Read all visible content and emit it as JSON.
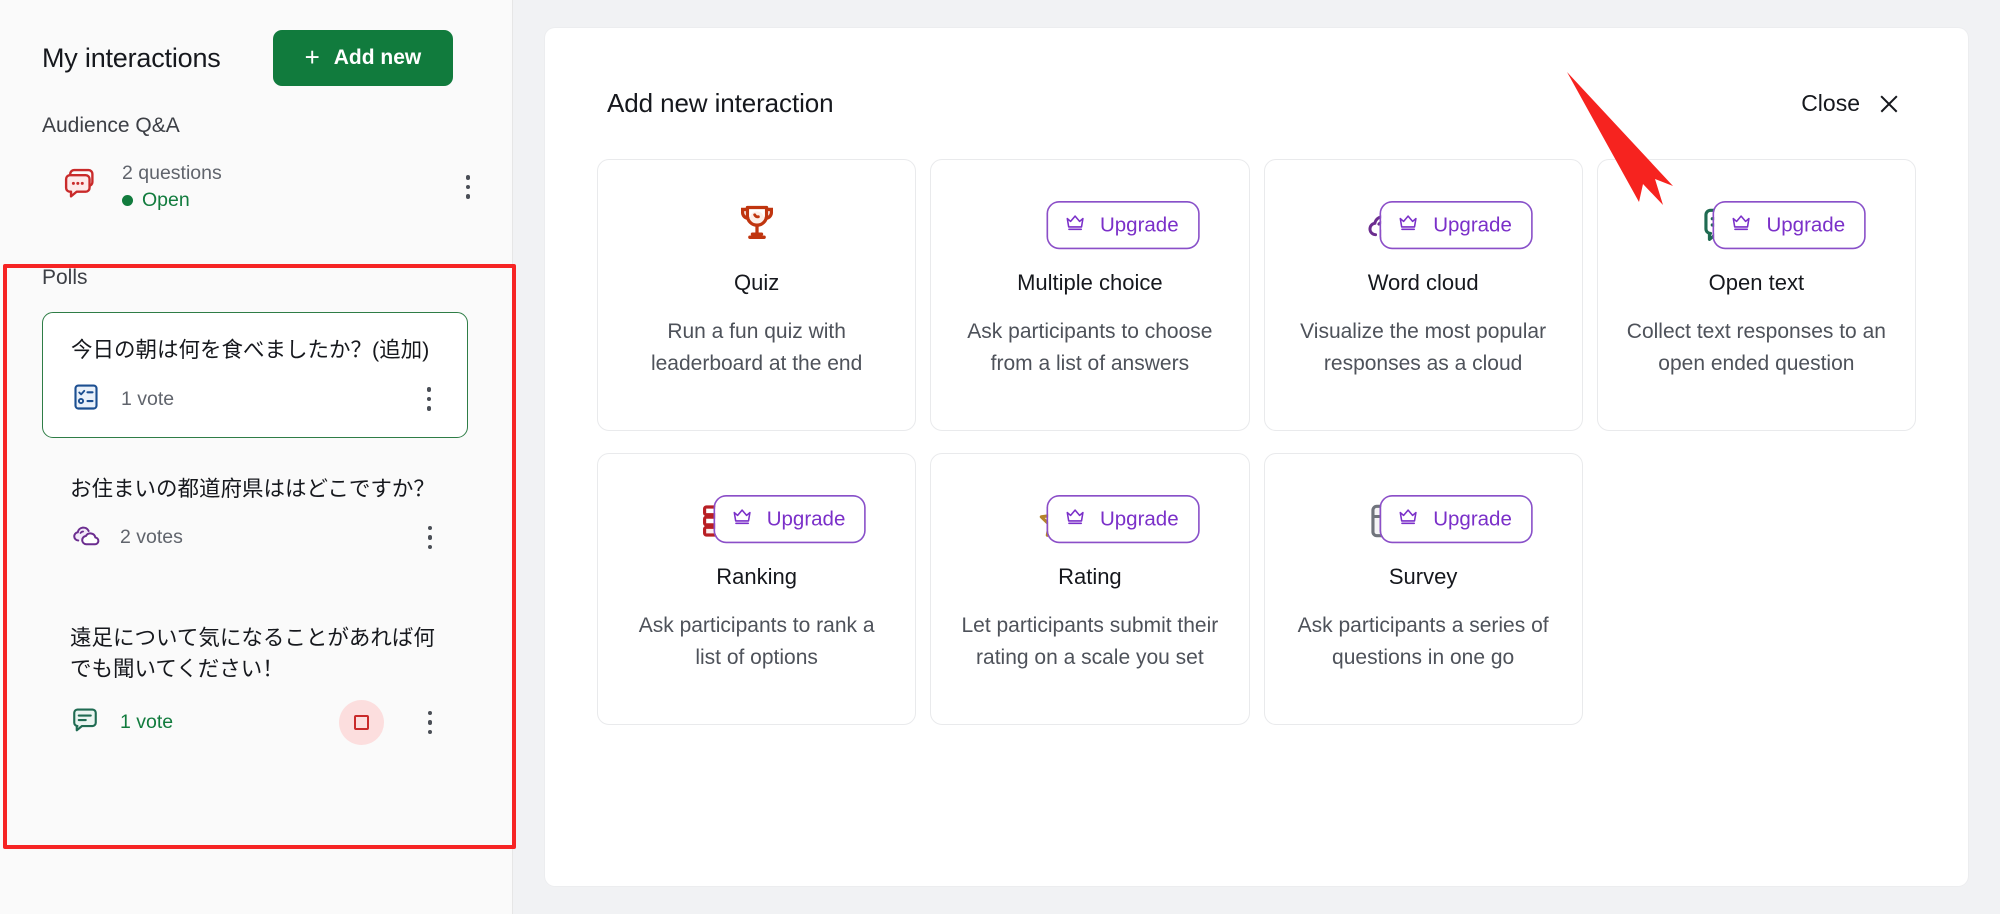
{
  "sidebar": {
    "title": "My interactions",
    "add_new_label": "Add new",
    "add_new_plus": "+",
    "qa_section_label": "Audience Q&A",
    "qa_item": {
      "icon": "qa-chat-icon",
      "count_label": "2 questions",
      "status_label": "Open",
      "status_color": "#117b3d",
      "menu_icon": "kebab-menu-icon"
    },
    "polls_section_label": "Polls",
    "polls": [
      {
        "question": "今日の朝は何を食べましたか？(追加)",
        "icon": "multiple-choice-icon",
        "votes_label": "1 vote",
        "selected": true,
        "votes_color": "#60646c",
        "menu_icon": "kebab-menu-icon"
      },
      {
        "question": "お住まいの都道府県ははどこですか？",
        "icon": "word-cloud-icon",
        "votes_label": "2 votes",
        "selected": false,
        "votes_color": "#60646c",
        "menu_icon": "kebab-menu-icon"
      },
      {
        "question": "遠足について気になることがあれば何でも聞いてください！",
        "icon": "open-text-icon",
        "votes_label": "1 vote",
        "selected": false,
        "votes_color": "#117b3d",
        "stop_button_icon": "stop-square-icon",
        "menu_icon": "kebab-menu-icon"
      }
    ],
    "highlight_color": "#f62424"
  },
  "main": {
    "panel_title": "Add new interaction",
    "close_label": "Close",
    "close_icon": "close-x-icon",
    "upgrade_label": "Upgrade",
    "cards": [
      {
        "title": "Quiz",
        "description": "Run a fun quiz with leaderboard at the end",
        "icon": "trophy-icon",
        "icon_color": "#c0350f",
        "upgrade": false
      },
      {
        "title": "Multiple choice",
        "description": "Ask participants to choose from a list of answers",
        "icon": "multiple-choice-icon",
        "icon_color": "#1c4f91",
        "upgrade": true,
        "annotated": true
      },
      {
        "title": "Word cloud",
        "description": "Visualize the most popular responses as a cloud",
        "icon": "word-cloud-icon",
        "icon_color": "#6b2d8f",
        "upgrade": true
      },
      {
        "title": "Open text",
        "description": "Collect text responses to an open ended question",
        "icon": "open-text-icon",
        "icon_color": "#1f6b52",
        "upgrade": true
      },
      {
        "title": "Ranking",
        "description": "Ask participants to rank a list of options",
        "icon": "ranking-bars-icon",
        "icon_color": "#b81f24",
        "upgrade": true
      },
      {
        "title": "Rating",
        "description": "Let participants submit their rating on a scale you set",
        "icon": "star-rating-icon",
        "icon_color": "#b5842a",
        "upgrade": true
      },
      {
        "title": "Survey",
        "description": "Ask participants a series of questions in one go",
        "icon": "survey-icon",
        "icon_color": "#70747c",
        "upgrade": true
      }
    ],
    "annotation": {
      "type": "red-arrow",
      "color": "#f6231f",
      "points_to": "Multiple choice Upgrade badge"
    }
  },
  "colors": {
    "brand_green": "#117b3d",
    "upgrade_purple": "#7b30c9",
    "highlight_red": "#f62424",
    "panel_bg": "#ffffff",
    "app_bg": "#f1f2f4",
    "sidebar_bg": "#fafafa"
  }
}
